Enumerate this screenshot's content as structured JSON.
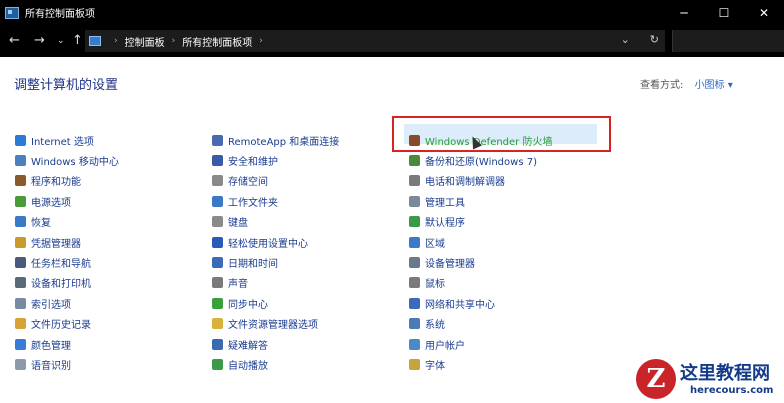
{
  "window": {
    "title": "所有控制面板项"
  },
  "address": {
    "crumbs": [
      "控制面板",
      "所有控制面板项"
    ]
  },
  "header": {
    "title": "调整计算机的设置",
    "view_by_label": "查看方式:",
    "view_by_value": "小图标 ▾"
  },
  "columns": [
    [
      {
        "label": "Internet 选项",
        "icon": "globe-icon",
        "color": "#2a7ad8"
      },
      {
        "label": "Windows 移动中心",
        "icon": "mobility-icon",
        "color": "#4a7fc0"
      },
      {
        "label": "程序和功能",
        "icon": "programs-icon",
        "color": "#8a5a2a"
      },
      {
        "label": "电源选项",
        "icon": "power-icon",
        "color": "#4a9a3a"
      },
      {
        "label": "恢复",
        "icon": "recovery-icon",
        "color": "#3a78c8"
      },
      {
        "label": "凭据管理器",
        "icon": "credential-icon",
        "color": "#c89a2a"
      },
      {
        "label": "任务栏和导航",
        "icon": "taskbar-icon",
        "color": "#4a5a7a"
      },
      {
        "label": "设备和打印机",
        "icon": "printer-icon",
        "color": "#5a6a7a"
      },
      {
        "label": "索引选项",
        "icon": "index-icon",
        "color": "#7a8aa0"
      },
      {
        "label": "文件历史记录",
        "icon": "file-history-icon",
        "color": "#d8a23a"
      },
      {
        "label": "颜色管理",
        "icon": "color-icon",
        "color": "#3a7ad8"
      },
      {
        "label": "语音识别",
        "icon": "microphone-icon",
        "color": "#8a9aaa"
      }
    ],
    [
      {
        "label": "RemoteApp 和桌面连接",
        "icon": "remoteapp-icon",
        "color": "#4a6ab0"
      },
      {
        "label": "安全和维护",
        "icon": "flag-icon",
        "color": "#3a5aa8"
      },
      {
        "label": "存储空间",
        "icon": "storage-icon",
        "color": "#8a8a8a"
      },
      {
        "label": "工作文件夹",
        "icon": "folder-icon",
        "color": "#3a78c8"
      },
      {
        "label": "键盘",
        "icon": "keyboard-icon",
        "color": "#8a8a8a"
      },
      {
        "label": "轻松使用设置中心",
        "icon": "ease-of-access-icon",
        "color": "#2a5ab8"
      },
      {
        "label": "日期和时间",
        "icon": "calendar-icon",
        "color": "#3a6ab8"
      },
      {
        "label": "声音",
        "icon": "speaker-icon",
        "color": "#7a7a7a"
      },
      {
        "label": "同步中心",
        "icon": "sync-icon",
        "color": "#3aa03a"
      },
      {
        "label": "文件资源管理器选项",
        "icon": "folder-options-icon",
        "color": "#d8b23a"
      },
      {
        "label": "疑难解答",
        "icon": "troubleshoot-icon",
        "color": "#3a6ab0"
      },
      {
        "label": "自动播放",
        "icon": "autoplay-icon",
        "color": "#3a9a4a"
      }
    ],
    [
      {
        "label": "Windows Defender 防火墙",
        "icon": "firewall-icon",
        "color": "#8a4a2a",
        "highlight": true
      },
      {
        "label": "备份和还原(Windows 7)",
        "icon": "backup-icon",
        "color": "#4a8a3a"
      },
      {
        "label": "电话和调制解调器",
        "icon": "phone-icon",
        "color": "#7a7a7a"
      },
      {
        "label": "管理工具",
        "icon": "admin-tools-icon",
        "color": "#7a8a9a"
      },
      {
        "label": "默认程序",
        "icon": "default-programs-icon",
        "color": "#3a9a4a"
      },
      {
        "label": "区域",
        "icon": "region-icon",
        "color": "#3a7ac8"
      },
      {
        "label": "设备管理器",
        "icon": "device-manager-icon",
        "color": "#6a7a8a"
      },
      {
        "label": "鼠标",
        "icon": "mouse-icon",
        "color": "#7a7a7a"
      },
      {
        "label": "网络和共享中心",
        "icon": "network-icon",
        "color": "#3a6ab8"
      },
      {
        "label": "系统",
        "icon": "system-icon",
        "color": "#4a7ab8"
      },
      {
        "label": "用户帐户",
        "icon": "user-accounts-icon",
        "color": "#4a8ac8"
      },
      {
        "label": "字体",
        "icon": "fonts-icon",
        "color": "#c8a23a"
      }
    ]
  ],
  "watermark": {
    "title": "这里教程网",
    "url": "herecours.com"
  }
}
